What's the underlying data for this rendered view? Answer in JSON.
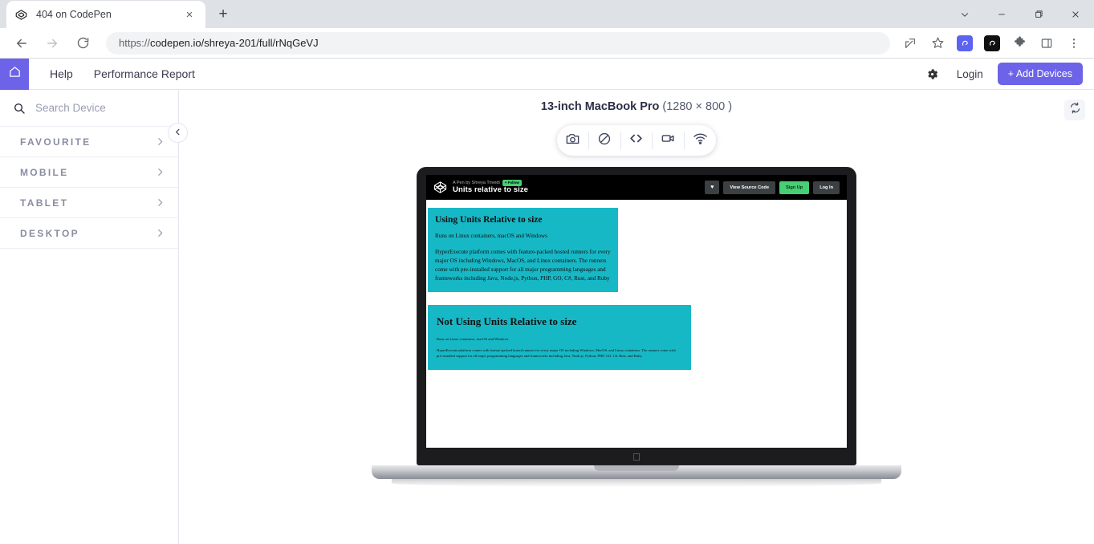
{
  "browser": {
    "tab": {
      "title": "404 on CodePen",
      "favicon": "codepen-icon",
      "close": "×"
    },
    "new_tab": "+",
    "window_controls": [
      "chevron-down-icon",
      "minimize-icon",
      "maximize-icon",
      "close-icon"
    ],
    "nav": {
      "back": "back-icon",
      "forward": "forward-icon",
      "reload": "reload-icon"
    },
    "url_scheme": "https://",
    "url_rest": "codepen.io/shreya-201/full/rNqGeVJ",
    "toolbar_icons": [
      "share-icon",
      "bookmark-star-icon",
      "extension-blue-icon",
      "extension-black-icon",
      "puzzle-extensions-icon",
      "side-panel-icon",
      "chrome-menu-icon"
    ]
  },
  "app_header": {
    "home": "home-icon",
    "nav": [
      {
        "label": "Help"
      },
      {
        "label": "Performance Report"
      }
    ],
    "settings_icon": "gear-icon",
    "login_label": "Login",
    "add_devices_label": "+ Add Devices"
  },
  "sidebar": {
    "search_placeholder": "Search Device",
    "search_value": "",
    "categories": [
      {
        "label": "FAVOURITE"
      },
      {
        "label": "MOBILE"
      },
      {
        "label": "TABLET"
      },
      {
        "label": "DESKTOP"
      }
    ],
    "collapse_icon": "chevron-left-icon"
  },
  "stage": {
    "device_name": "13-inch MacBook Pro",
    "device_resolution": "(1280 × 800 )",
    "refresh_icon": "refresh-icon",
    "actions": [
      {
        "name": "screenshot",
        "icon": "camera-icon"
      },
      {
        "name": "block",
        "icon": "no-entry-icon"
      },
      {
        "name": "inspect-code",
        "icon": "code-brackets-icon"
      },
      {
        "name": "record-video",
        "icon": "video-camera-icon"
      },
      {
        "name": "network-throttle",
        "icon": "wifi-icon"
      }
    ]
  },
  "pen": {
    "logo": "codepen-icon",
    "byline": "A Pen by Shreya Trivedi",
    "follow_label": "+ Follow",
    "title": "Units relative to size",
    "buttons": {
      "heart": "♥",
      "view_source": "View Source Code",
      "sign_up": "Sign Up",
      "log_in": "Log In"
    },
    "card_a": {
      "heading": "Using Units Relative to size",
      "line1": "Runs on Linux containers, macOS and Windows",
      "line2": "HyperExecute platform comes with feature-packed hosted runners for every major OS including Windows, MacOS, and Linux containers. The runners come with pre-installed support for all major programming languages and frameworks including Java, Node.js, Python, PHP, GO, C#, Rust, and Ruby"
    },
    "card_b": {
      "heading": "Not Using Units Relative to size",
      "line1": "Runs on Linux containers, macOS and Windows",
      "line2": "HyperExecute platform comes with feature-packed hosted runners for every major OS including Windows, MacOS, and Linux containers. The runners come with pre-installed support for all major programming languages and frameworks including Java, Node.js, Python, PHP, GO, C#, Rust, and Ruby."
    },
    "apple_logo": ""
  },
  "colors": {
    "brand_purple": "#6c63e8",
    "card_teal": "#17b8c6",
    "signup_green": "#47cf73",
    "pen_header_black": "#000000"
  }
}
